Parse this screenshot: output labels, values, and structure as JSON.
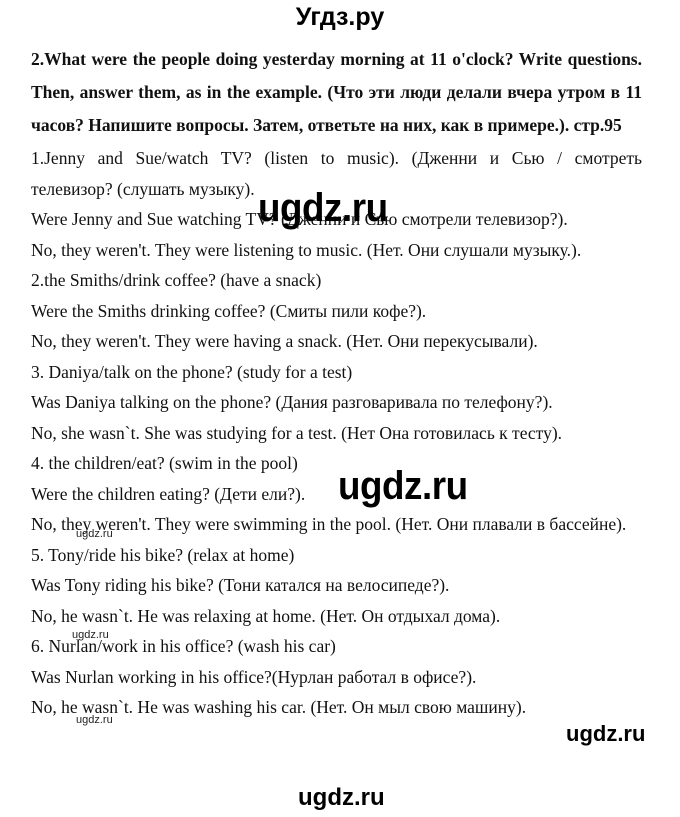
{
  "header": {
    "site_title": "Угдз.ру"
  },
  "task": {
    "heading": "2.What were the people doing yesterday morning at 11 o'clock? Write questions. Then, answer them, as in the example. (Что эти люди делали вчера утром в 11 часов? Напишите вопросы. Затем, ответьте на них, как в примере.). стр.95"
  },
  "items": [
    {
      "prompt_line1": "1.Jenny and Sue/watch TV? (listen to music). (Дженни и Сью / смотреть",
      "prompt_line2": "телевизор? (слушать музыку).",
      "question": "Were Jenny and Sue watching TV? (Дженни и Сью смотрели телевизор?).",
      "answer": "No, they weren't. They were listening to music. (Нет. Они слушали музыку.)."
    },
    {
      "prompt": "2.the Smiths/drink coffee? (have a snack)",
      "question": "Were the Smiths drinking coffee? (Смиты пили кофе?).",
      "answer": "No, they weren't. They were having a snack. (Нет. Они перекусывали)."
    },
    {
      "prompt": "3. Daniya/talk on the phone? (study for a test)",
      "question": "Was Daniya talking on the phone? (Дания разговаривала по телефону?).",
      "answer": "No, she wasn`t. She was studying for a test. (Нет Она готовилась к тесту)."
    },
    {
      "prompt": "4. the children/eat? (swim in the pool)",
      "question": "Were the children eating? (Дети ели?).",
      "answer": "No, they weren't. They were swimming in the pool. (Нет. Они плавали в бассейне)."
    },
    {
      "prompt": "5. Tony/ride his bike? (relax at home)",
      "question": "Was Tony riding his bike? (Тони катался на велосипеде?).",
      "answer": "No, he wasn`t.  He was relaxing at home. (Нет. Он отдыхал дома)."
    },
    {
      "prompt": "6. Nurlan/work in his office? (wash his car)",
      "question": "Was Nurlan working in his office?(Нурлан работал в офисе?).",
      "answer": "No, he wasn`t. He was washing his car. (Нет. Он мыл свою машину)."
    }
  ],
  "watermarks": {
    "text": "ugdz.ru"
  }
}
